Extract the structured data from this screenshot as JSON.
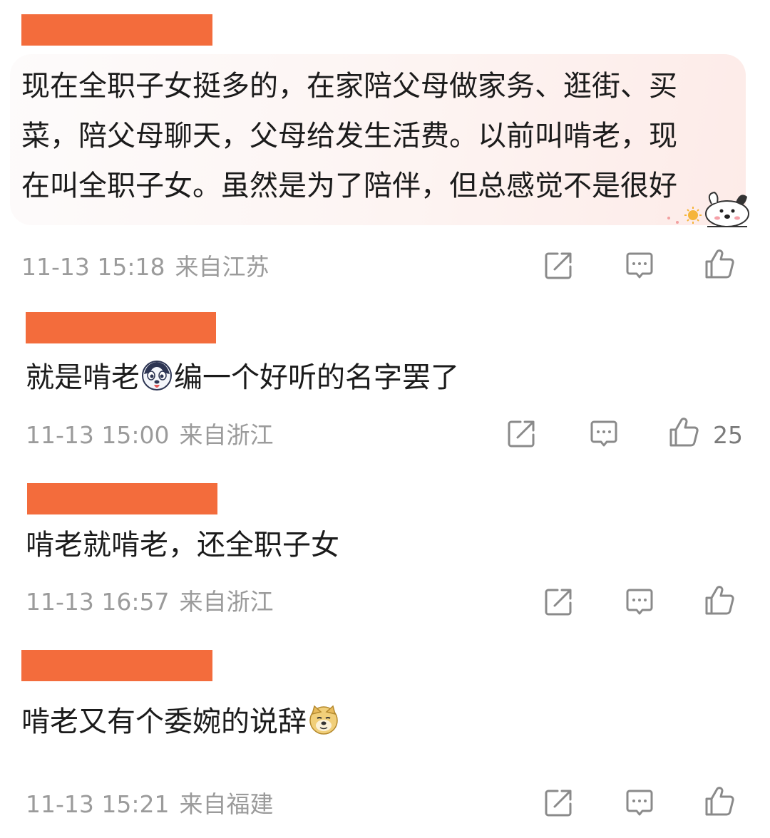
{
  "colors": {
    "redact": "#f36c3c",
    "meta_text": "#9b9b9b",
    "icon": "#8a8a8a"
  },
  "comments": [
    {
      "text_lines": [
        "现在全职子女挺多的，在家陪父母做家务、逛街、买",
        "菜，陪父母聊天，父母给发生活费。以前叫啃老，现",
        "在叫全职子女。虽然是为了陪伴，但总感觉不是很好"
      ],
      "time": "11-13 15:18",
      "location": "来自江苏",
      "bubble_sticker": "puppy-sticker"
    },
    {
      "text_before": "就是啃老",
      "emoji": "husky-emoji",
      "text_after": "编一个好听的名字罢了",
      "time": "11-13 15:00",
      "location": "来自浙江",
      "likes": "25"
    },
    {
      "text": "啃老就啃老，还全职子女",
      "time": "11-13 16:57",
      "location": "来自浙江"
    },
    {
      "text": "啃老又有个委婉的说辞",
      "emoji": "doge-emoji",
      "time": "11-13 15:21",
      "location": "来自福建"
    }
  ],
  "icons": {
    "share": "share-icon",
    "comment": "comment-icon",
    "like": "thumbs-up-icon"
  }
}
